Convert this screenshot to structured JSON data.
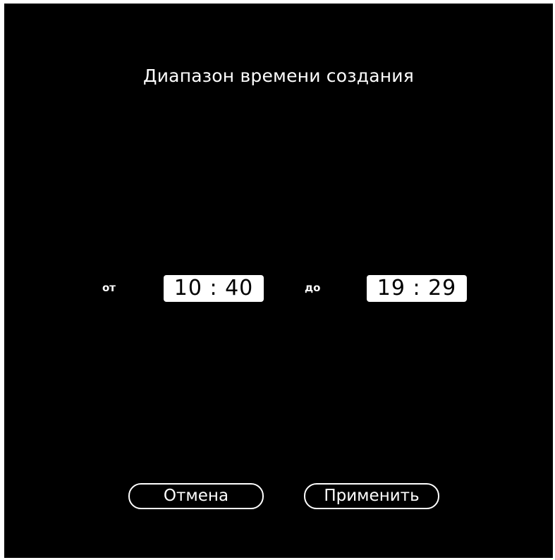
{
  "dialog": {
    "title": "Диапазон времени создания",
    "from_label": "от",
    "from_time": "10 : 40",
    "to_label": "до",
    "to_time": "19 : 29",
    "cancel_label": "Отмена",
    "apply_label": "Применить"
  },
  "colors": {
    "background": "#000000",
    "text": "#ffffff",
    "time_box_bg": "#ffffff",
    "time_box_text": "#000000"
  }
}
